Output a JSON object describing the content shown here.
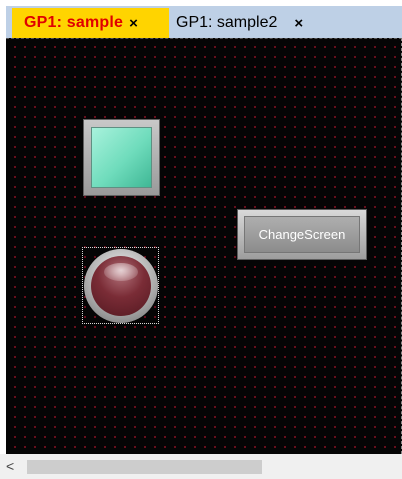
{
  "tabs": [
    {
      "label": "GP1: sample",
      "close_icon": "×",
      "active": true,
      "label_color": "#e00000",
      "background": "#ffd400"
    },
    {
      "label": "GP1: sample2",
      "close_icon": "×",
      "active": false
    }
  ],
  "canvas": {
    "background": "#050505",
    "grid_dot_color": "#7a1020"
  },
  "widgets": {
    "lamp": {
      "color": "#6fdcbc"
    },
    "push_button": {
      "color": "#7a2c36",
      "selected": true
    },
    "change_screen_button": {
      "label": "ChangeScreen"
    }
  },
  "scrollbar": {
    "left_arrow": "<"
  }
}
